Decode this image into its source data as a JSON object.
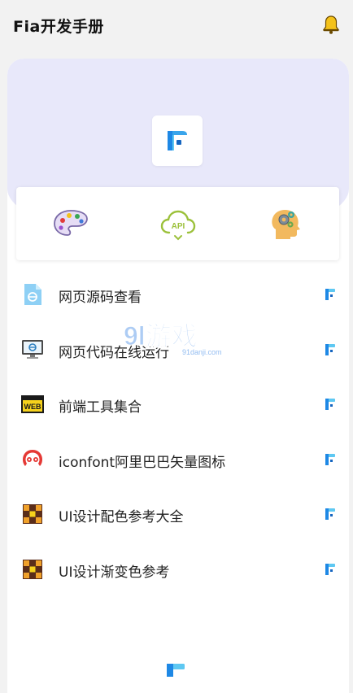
{
  "header": {
    "title": "Fia开发手册",
    "bell_icon": "bell-icon"
  },
  "hero": {
    "logo_icon": "fia-logo-icon"
  },
  "quick_actions": [
    {
      "icon": "palette-icon"
    },
    {
      "icon": "api-cloud-icon"
    },
    {
      "icon": "gear-head-icon"
    }
  ],
  "items": [
    {
      "label": "网页源码查看",
      "icon": "html-file-icon"
    },
    {
      "label": "网页代码在线运行",
      "icon": "monitor-code-icon"
    },
    {
      "label": "前端工具集合",
      "icon": "web-badge-icon"
    },
    {
      "label": "iconfont阿里巴巴矢量图标",
      "icon": "iconfont-logo-icon"
    },
    {
      "label": "UI设计配色参考大全",
      "icon": "color-grid-icon"
    },
    {
      "label": "UI设计渐变色参考",
      "icon": "color-grid-icon"
    }
  ],
  "watermark": {
    "main": "9l游戏",
    "sub": "91danji.com"
  },
  "colors": {
    "accent_blue": "#1e88e5",
    "accent_cyan": "#5ec8f2",
    "hero_bg": "#e8e8fa"
  }
}
